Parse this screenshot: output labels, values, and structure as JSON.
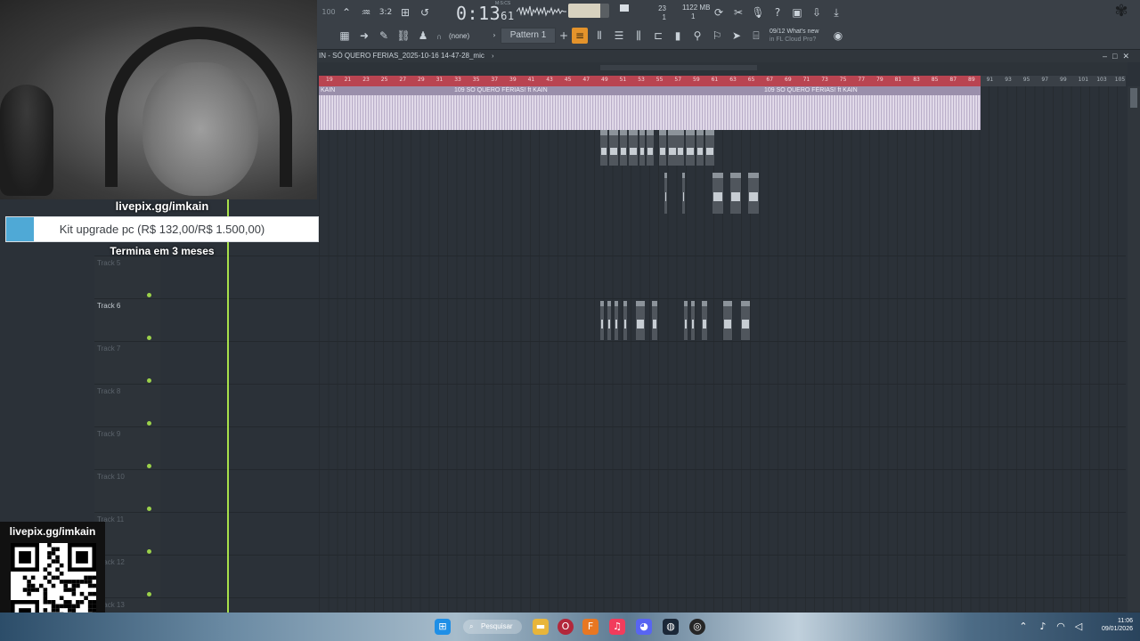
{
  "toolbar": {
    "time": "0:13",
    "time_frac": "61",
    "time_unit": "M:S:CS",
    "cpu": "23",
    "poly": "1",
    "memory": "1122 MB",
    "memory_sub": "1",
    "snap": "(none)",
    "pattern": "Pattern 1",
    "news_line1": "09/12  What's new",
    "news_line2": "in FL Cloud Pro?",
    "master_volume_level": 0.78
  },
  "playlist": {
    "title": "IN - SÓ QUERO FERIAS_2025-10-16 14-47-28_mic",
    "ruler_ticks": [
      "19",
      "21",
      "23",
      "25",
      "27",
      "29",
      "31",
      "33",
      "35",
      "37",
      "39",
      "41",
      "43",
      "45",
      "47",
      "49",
      "51",
      "53",
      "55",
      "57",
      "59",
      "61",
      "63",
      "65",
      "67",
      "69",
      "71",
      "73",
      "75",
      "77",
      "79",
      "81",
      "83",
      "85",
      "87",
      "89",
      "91",
      "93",
      "95",
      "97",
      "99",
      "101",
      "103",
      "105"
    ],
    "clip_label_main": "KAIN",
    "clip_label_a": "109 SÓ QUERO FÉRIAS! ft KAIN",
    "clip_label_b": "109 SÓ QUERO FÉRIAS! ft KAIN",
    "tracks": [
      {
        "name": "Track 5",
        "active": false
      },
      {
        "name": "Track 6",
        "active": true
      },
      {
        "name": "Track 7",
        "active": false
      },
      {
        "name": "Track 8",
        "active": false
      },
      {
        "name": "Track 9",
        "active": false
      },
      {
        "name": "Track 10",
        "active": false
      },
      {
        "name": "Track 11",
        "active": false
      },
      {
        "name": "Track 12",
        "active": false
      },
      {
        "name": "Track 13",
        "active": false
      }
    ]
  },
  "overlay": {
    "link_top": "livepix.gg/imkain",
    "goal_text": "Kit upgrade pc (R$ 132,00/R$ 1.500,00)",
    "goal_fraction": 0.088,
    "goal_end": "Termina em 3 meses",
    "qr_title": "livepix.gg/imkain"
  },
  "taskbar": {
    "search": "Pesquisar",
    "time": "11:06",
    "date": "09/01/2026"
  }
}
